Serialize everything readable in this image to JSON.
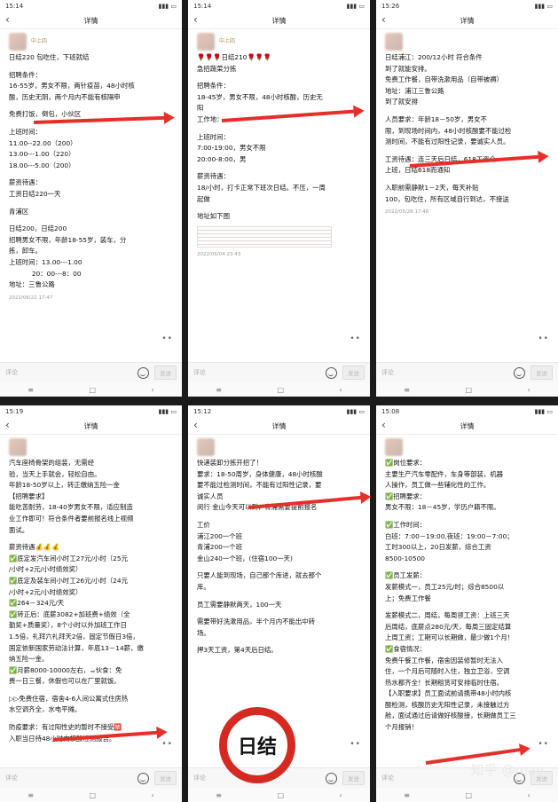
{
  "colors": {
    "arrow": "#e5302a",
    "check": "#3dbd4a",
    "stamp_ring": "#d42a22"
  },
  "watermark": "知乎 @may",
  "phones": [
    {
      "status_time": "15:14",
      "nav_title": "详情",
      "poster": "中上四",
      "comment_placeholder": "评论",
      "send_label": "发送",
      "post_time": "2022/06/22 17:47",
      "lines": [
        "日结220 包吃住，下班就结",
        "",
        "招聘条件：",
        "16-55岁，男女不限，两针疫苗，48小时核",
        "酸，历史无阴，两个月内不能有核隔申",
        "",
        "免费打饭，倒包，小伙区",
        "",
        "上班时间：",
        "11.00--22.00（200）",
        "13.00---1.00（220）",
        "18.00---5.00（200）",
        "",
        "薪资待遇：",
        "工资日结220一天",
        "",
        "青浦区",
        "",
        "日结200，日结200",
        "招聘男女不限，年龄18-55岁，装车，分",
        "拣，卸车。",
        "上班时间：13.00---1.00",
        "           20：00---8：00",
        "地址：三鲁公路"
      ]
    },
    {
      "status_time": "15:14",
      "nav_title": "详情",
      "poster": "中上四",
      "comment_placeholder": "评论",
      "send_label": "发送",
      "post_time": "2022/06/04 23:43",
      "lines": [
        "🌹🌹🌹日结210🌹🌹🌹",
        "急招蔬菜分拣",
        "",
        "招聘条件：",
        "18-45岁，男女不限，48小时核酸，历史无",
        "阳",
        "工作地：",
        "",
        "上班时间：",
        "7:00-19:00，男女不限",
        "20:00-8:00，男",
        "",
        "薪资待遇：",
        "18/小时，打卡正常下班次日结。不压，一周",
        "起做",
        "",
        "地址如下图"
      ]
    },
    {
      "status_time": "15:26",
      "nav_title": "详情",
      "poster": "",
      "comment_placeholder": "评论",
      "send_label": "发送",
      "post_time": "2022/05/28 17:46",
      "lines": [
        "日结浦江：200/12小时 符合条件",
        "到了就能安排。",
        "免费工作餐，自带洗漱用品（自带被褥）",
        "地址：浦江三鲁公路",
        "到了就安排",
        "",
        "人员要求：年龄18－50岁，男女不",
        "限，到现场时间内，48小时核酸要不能过检",
        "测时间，不能有过阳性记录，要诚实人员。",
        "",
        "工资待遇：连三天后日结，618工资全",
        "上班，日结618而通知",
        "",
        "入职前需静默1－2天，每天补贴",
        "100，包吃住，所有区域自行到达，不接送"
      ]
    },
    {
      "status_time": "15:19",
      "nav_title": "详情",
      "poster": "",
      "comment_placeholder": "评论",
      "send_label": "发送",
      "lines": [
        "汽车座椅骨架的组装，无需经",
        "验，当天上手就会，轻松自由。",
        "年龄18-50岁以上，转正缴纳五险一金",
        "【招聘要求】",
        "能吃苦耐劳，18-40岁男女不限，适应制造",
        "业工作即可！符合条件者要前报名线上视频",
        "面试。",
        "",
        "薪资待遇💰💰💰",
        "✅底定发汽车间小时工27元/小时（25元",
        "/小时+2元/小时绩效奖）",
        "✅底定及装车间小时工26元/小时（24元",
        "/小时+2元/小时绩效奖）",
        "✅264－324元/天",
        "✅转正后：底薪3082+加班费+绩效（全",
        "勤奖+质量奖），8个小时以外加班工作日",
        "1.5倍，礼拜六礼拜天2倍，固定节假日3倍，",
        "国定依新国家劳动法计算，年底13－14薪，缴",
        "纳五险一金。",
        "✅月薪8000-10000左右，☕伙食：免",
        "费一日三餐，休假也可以在厂里就饭。",
        "",
        "▷▷免费住宿，宿舍4-6人间公寓式住房热",
        "水空调齐全，水电平摊。",
        "",
        "防疫要求：有过阳性史的暂时不接受🈲",
        "入职当日持48小时内核酸检测报告。"
      ]
    },
    {
      "status_time": "15:12",
      "nav_title": "详情",
      "poster": "",
      "comment_placeholder": "评论",
      "send_label": "发送",
      "stamp_text": "日结",
      "lines": [
        "快递装卸分拣开招了！",
        "要求：18-50周岁，身体健康，48小时核酸",
        "要不能过检测时间，不能有过阳性记录，要",
        "诚实人员",
        "闵行 金山今天可以到，青浦需要提前报名",
        "",
        "工价",
        "浦江200一个班",
        "青浦200一个班",
        "金山240一个班，(住宿100一天)",
        "",
        "只要人能到现场，自己那个库进，就去那个",
        "库。",
        "",
        "员工需要静默两天，100一天",
        "",
        "需要带好洗漱用品，半个月内不能出中转",
        "场。",
        "",
        "押3天工资，第4天后日结。"
      ]
    },
    {
      "status_time": "15:08",
      "nav_title": "详情",
      "poster": "",
      "comment_placeholder": "评论",
      "send_label": "发送",
      "lines": [
        "✅岗位要求：",
        "主要生产汽车零配件，车身等部装，机器",
        "人操作，员工做一些辅化性的工作。",
        "✅招聘要求：",
        "男女不限：18－45岁，学历户籍不限。",
        "",
        "✅工作时间：",
        "白班：7:00－19:00,夜班：19:00－7:00；",
        "工时300以上，20日发薪，综合工资",
        "8500-10500",
        "",
        "✅员工发薪：",
        "发薪模式一，员工25元/时；综合8500以",
        "上；免费工作餐",
        "",
        "发薪模式二，周结，每周领工资：上班三天",
        "后周结，底薪点280元/天，每周三固定结算",
        "上周工资；工期可以长期做，最少做1个月！",
        "✅食宿情况：",
        "免费午餐工作餐，宿舍因装修暂时无法入",
        "住，一个月后可随时入住，独立卫浴，空调",
        "热水都齐全！长期租赁可安排临时住宿。",
        "【入职要求】员工面试前请携带48小时内核",
        "酸检测，核酸历史无阳性记录，未接触过方",
        "舱，面试通过后请做好核酸接，长期做员工三",
        "个月报销！"
      ]
    }
  ]
}
